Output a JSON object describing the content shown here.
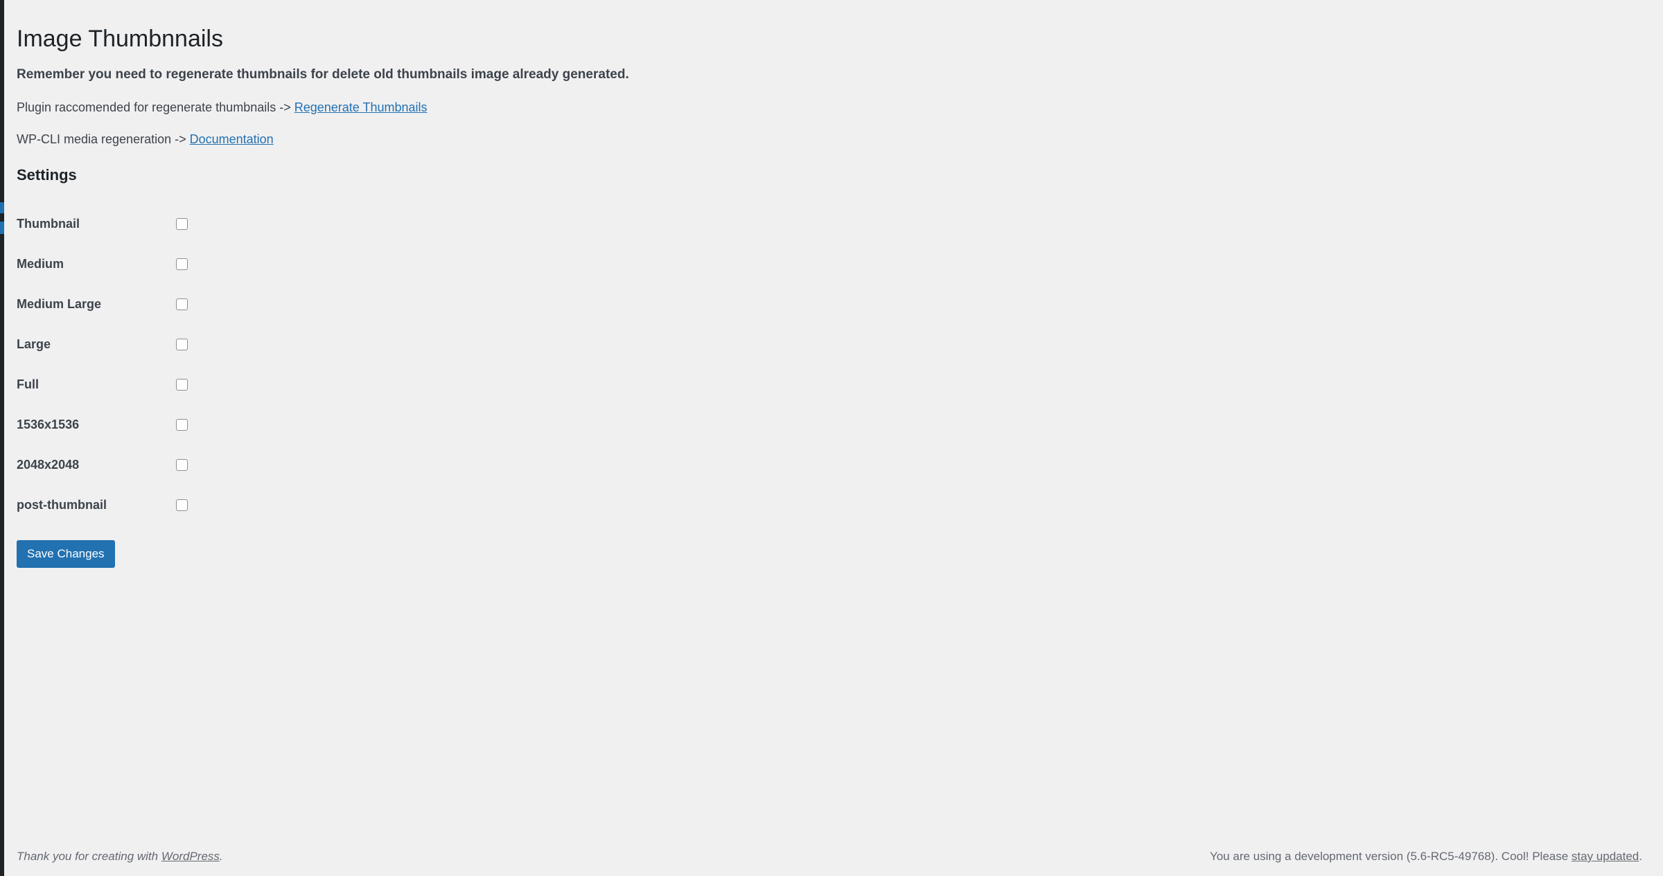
{
  "colors": {
    "accent": "#2271b1",
    "background": "#f0f0f1",
    "admin_rail": "#1d2327",
    "text": "#3c434a",
    "heading": "#1d2327",
    "muted": "#646970",
    "checkbox_border": "#8c8f94"
  },
  "page": {
    "title": "Image Thumbnnails",
    "notice_strong": "Remember you need to regenerate thumbnails for delete old thumbnails image already generated.",
    "plugin_line_prefix": "Plugin raccomended for regenerate thumbnails ->",
    "plugin_link_label": "Regenerate Thumbnails",
    "wpcli_line_prefix": "WP-CLI media regeneration ->",
    "wpcli_link_label": "Documentation",
    "settings_heading": "Settings"
  },
  "settings": {
    "rows": [
      {
        "label": "Thumbnail",
        "checked": false
      },
      {
        "label": "Medium",
        "checked": false
      },
      {
        "label": "Medium Large",
        "checked": false
      },
      {
        "label": "Large",
        "checked": false
      },
      {
        "label": "Full",
        "checked": false
      },
      {
        "label": "1536x1536",
        "checked": false
      },
      {
        "label": "2048x2048",
        "checked": false
      },
      {
        "label": "post-thumbnail",
        "checked": false
      }
    ]
  },
  "submit": {
    "save_label": "Save Changes"
  },
  "footer": {
    "left_prefix": "Thank you for creating with ",
    "left_link_label": "WordPress",
    "left_suffix": ".",
    "right_prefix": "You are using a development version (5.6-RC5-49768). Cool! Please ",
    "right_link_label": "stay updated",
    "right_suffix": "."
  }
}
